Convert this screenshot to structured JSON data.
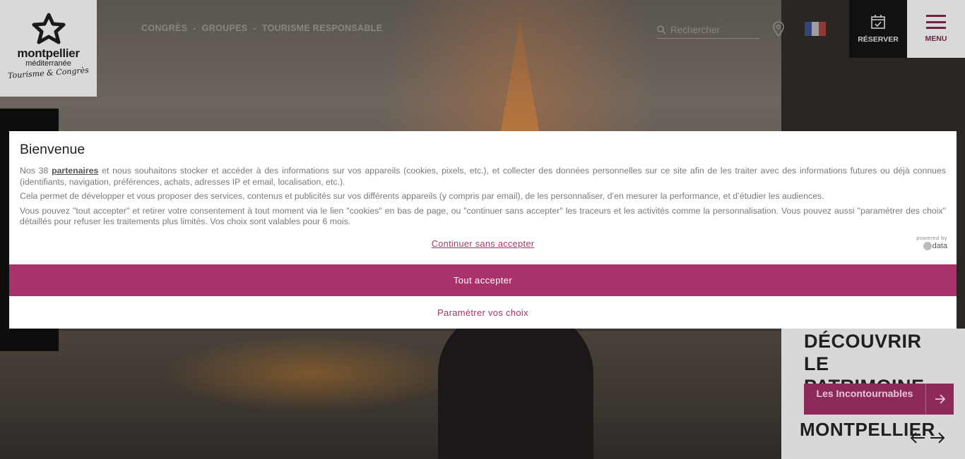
{
  "logo": {
    "line1": "montpellier",
    "line2": "méditerranée",
    "line3": "Tourisme & Congrès"
  },
  "topnav": {
    "items": [
      "CONGRÈS",
      "GROUPES",
      "TOURISME RESPONSABLE"
    ],
    "separator": "-"
  },
  "search": {
    "placeholder": "Rechercher"
  },
  "header": {
    "reserve_label": "RÉSERVER",
    "menu_label": "MENU"
  },
  "colors": {
    "brand": "#a83269",
    "panel_button": "#8d2a5a"
  },
  "panel": {
    "title": "DÉCOUVRIR LE PATRIMOINE",
    "button_label": "Les Incontournables",
    "subtitle": "MONTPELLIER"
  },
  "cookie_modal": {
    "title": "Bienvenue",
    "p1_before": "Nos 38 ",
    "p1_link": "partenaires",
    "p1_after": " et nous souhaitons stocker et accéder à des informations sur vos appareils (cookies, pixels, etc.), et collecter des données personnelles sur ce site afin de les traiter avec des informations futures ou déjà connues (identifiants, navigation, préférences, achats, adresses IP et email, localisation, etc.).",
    "p2": "Cela permet de développer et vous proposer des services, contenus et publicités sur vos différents appareils (y compris par email), de les personnaliser, d’en mesurer la performance, et d’étudier les audiences.",
    "p3": "Vous pouvez \"tout accepter\" et retirer votre consentement à tout moment via le lien \"cookies\" en bas de page, ou \"continuer sans accepter\" les traceurs et les activités comme la personnalisation. Vous pouvez aussi \"paramétrer des choix\" détaillés pour refuser les traitements plus limités. Vos choix sont valables pour 6 mois.",
    "continue_label": "Continuer sans accepter",
    "powered_by": "powered by",
    "powered_brand": "data",
    "accept_label": "Tout accepter",
    "params_label": "Paramétrer vos choix"
  }
}
